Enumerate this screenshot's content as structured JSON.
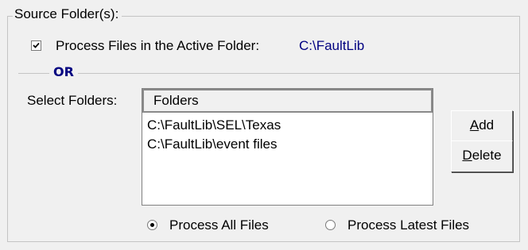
{
  "group": {
    "title": "Source Folder(s):"
  },
  "active_folder": {
    "checkbox_label": "Process Files in the Active Folder:",
    "checked": true,
    "path": "C:\\FaultLib"
  },
  "separator": {
    "label": "OR"
  },
  "select_folders": {
    "label": "Select Folders:",
    "list_header": "Folders",
    "items": [
      "C:\\FaultLib\\SEL\\Texas",
      "C:\\FaultLib\\event files"
    ]
  },
  "buttons": {
    "add": {
      "access_key": "A",
      "rest": "dd"
    },
    "delete": {
      "access_key": "D",
      "rest": "elete"
    }
  },
  "process_mode": {
    "all_label": "Process All Files",
    "latest_label": "Process Latest Files",
    "selected": "all"
  },
  "colors": {
    "panel_bg": "#f0f0f0",
    "path_text": "#000080",
    "or_label": "#000080"
  }
}
